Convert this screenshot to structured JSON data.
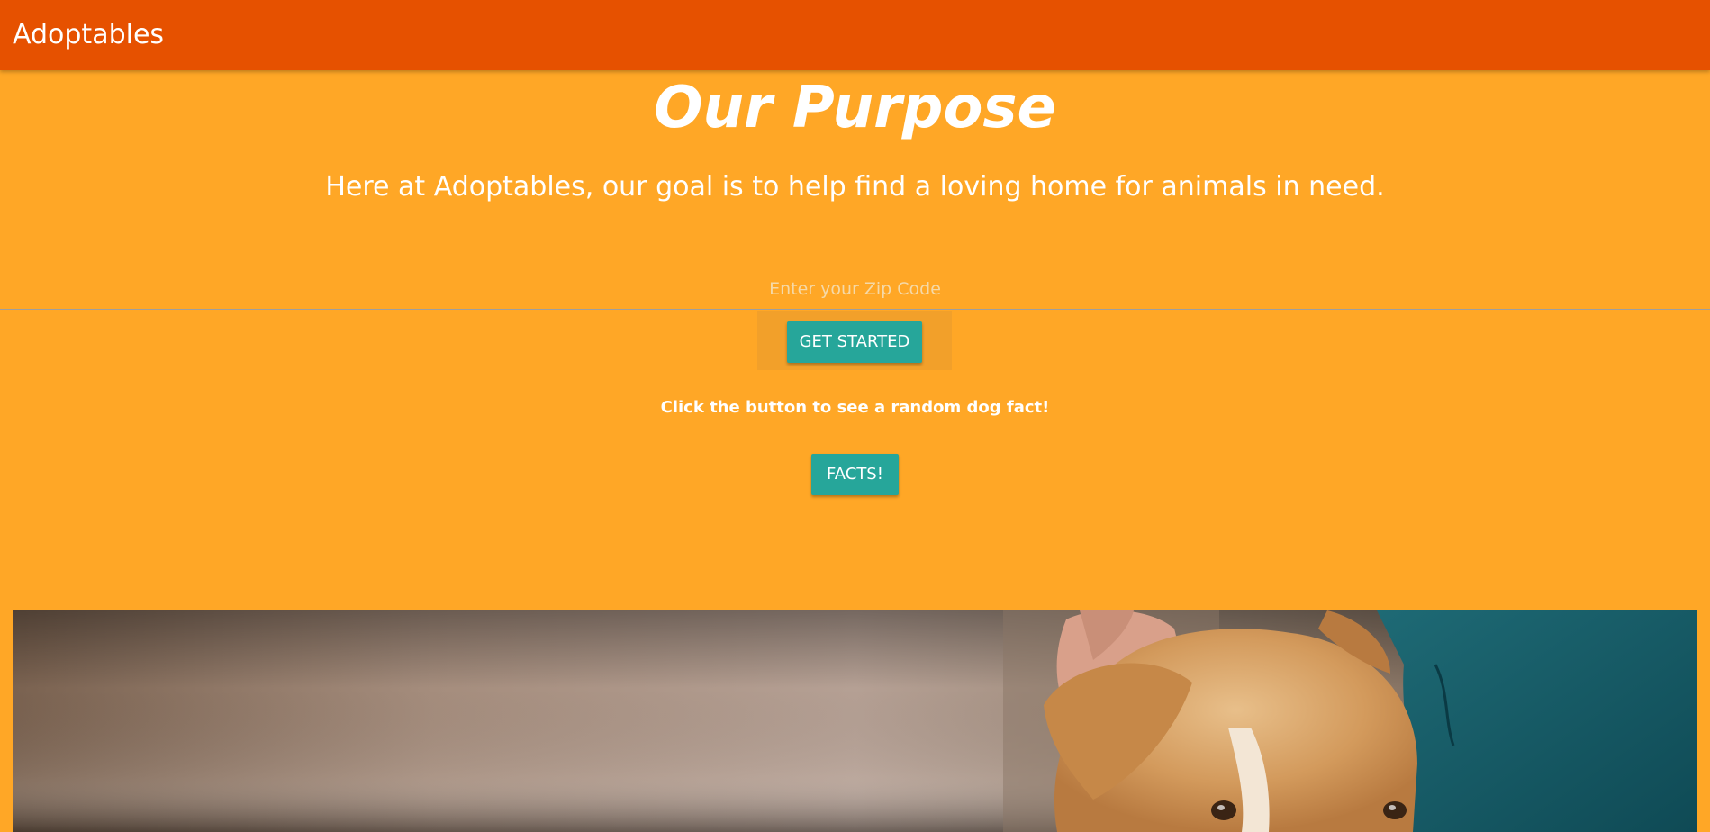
{
  "navbar": {
    "brand": "Adoptables"
  },
  "hero": {
    "title": "Our Purpose",
    "subtitle": "Here at Adoptables, our goal is to help find a loving home for animals in need.",
    "zip_placeholder": "Enter your Zip Code",
    "zip_value": "",
    "get_started_label": "GET STARTED",
    "fact_prompt": "Click the button to see a random dog fact!",
    "facts_label": "FACTS!"
  },
  "colors": {
    "navbar": "#e65100",
    "background": "#ffa726",
    "button": "#26a69a",
    "text": "#ffffff"
  },
  "icons": {
    "photo": "dog-photo"
  }
}
